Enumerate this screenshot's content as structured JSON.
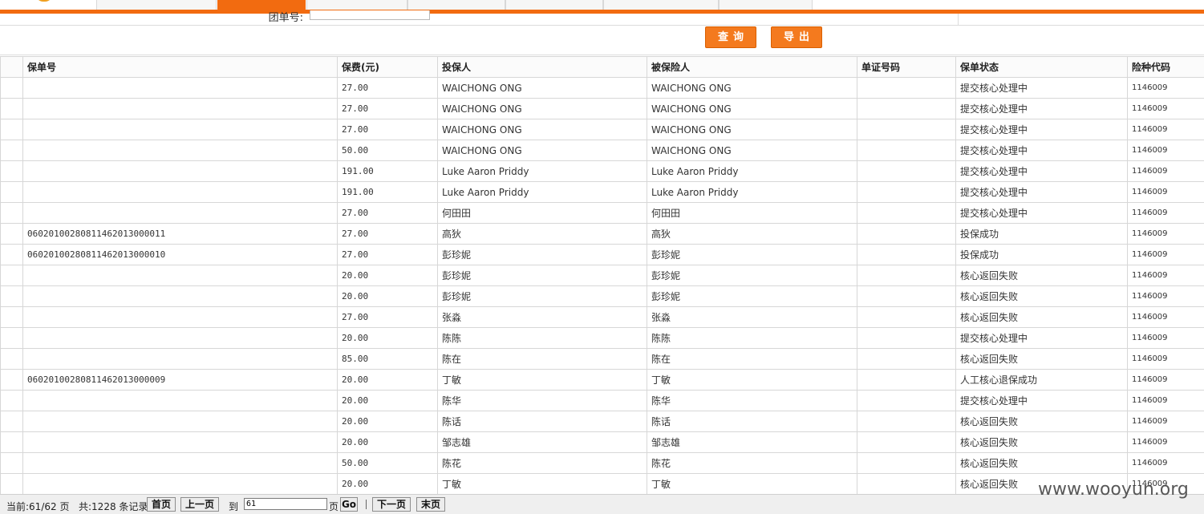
{
  "nav": {
    "tabs": [
      {
        "label": "",
        "active": false
      },
      {
        "label": "",
        "active": true
      },
      {
        "label": "",
        "active": false
      },
      {
        "label": "",
        "active": false
      },
      {
        "label": "",
        "active": false
      },
      {
        "label": "",
        "active": false
      },
      {
        "label": "",
        "active": false
      }
    ],
    "accent_color": "#f26b10"
  },
  "search": {
    "group_policy_label": "团单号:",
    "group_policy_value": "",
    "query_button": "查询",
    "export_button": "导出"
  },
  "table": {
    "headers": [
      "",
      "保单号",
      "保费(元)",
      "投保人",
      "被保险人",
      "单证号码",
      "保单状态",
      "险种代码"
    ],
    "rows": [
      {
        "policy_no": "",
        "premium": "27.00",
        "applicant": "WAICHONG ONG",
        "insured": "WAICHONG ONG",
        "cert_no": "",
        "status": "提交核心处理中",
        "product_code": "1146009"
      },
      {
        "policy_no": "",
        "premium": "27.00",
        "applicant": "WAICHONG ONG",
        "insured": "WAICHONG ONG",
        "cert_no": "",
        "status": "提交核心处理中",
        "product_code": "1146009"
      },
      {
        "policy_no": "",
        "premium": "27.00",
        "applicant": "WAICHONG ONG",
        "insured": "WAICHONG ONG",
        "cert_no": "",
        "status": "提交核心处理中",
        "product_code": "1146009"
      },
      {
        "policy_no": "",
        "premium": "50.00",
        "applicant": "WAICHONG ONG",
        "insured": "WAICHONG ONG",
        "cert_no": "",
        "status": "提交核心处理中",
        "product_code": "1146009"
      },
      {
        "policy_no": "",
        "premium": "191.00",
        "applicant": "Luke Aaron Priddy",
        "insured": "Luke Aaron Priddy",
        "cert_no": "",
        "status": "提交核心处理中",
        "product_code": "1146009"
      },
      {
        "policy_no": "",
        "premium": "191.00",
        "applicant": "Luke Aaron Priddy",
        "insured": "Luke Aaron Priddy",
        "cert_no": "",
        "status": "提交核心处理中",
        "product_code": "1146009"
      },
      {
        "policy_no": "",
        "premium": "27.00",
        "applicant": "何田田",
        "insured": "何田田",
        "cert_no": "",
        "status": "提交核心处理中",
        "product_code": "1146009"
      },
      {
        "policy_no": "0602010028081146201300001​1",
        "premium": "27.00",
        "applicant": "高狄",
        "insured": "高狄",
        "cert_no": "",
        "status": "投保成功",
        "product_code": "1146009"
      },
      {
        "policy_no": "06020100280811462013000010",
        "premium": "27.00",
        "applicant": "彭珍妮",
        "insured": "彭珍妮",
        "cert_no": "",
        "status": "投保成功",
        "product_code": "1146009"
      },
      {
        "policy_no": "",
        "premium": "20.00",
        "applicant": "彭珍妮",
        "insured": "彭珍妮",
        "cert_no": "",
        "status": "核心返回失败",
        "product_code": "1146009"
      },
      {
        "policy_no": "",
        "premium": "20.00",
        "applicant": "彭珍妮",
        "insured": "彭珍妮",
        "cert_no": "",
        "status": "核心返回失败",
        "product_code": "1146009"
      },
      {
        "policy_no": "",
        "premium": "27.00",
        "applicant": "张淼",
        "insured": "张淼",
        "cert_no": "",
        "status": "核心返回失败",
        "product_code": "1146009"
      },
      {
        "policy_no": "",
        "premium": "20.00",
        "applicant": "陈陈",
        "insured": "陈陈",
        "cert_no": "",
        "status": "提交核心处理中",
        "product_code": "1146009"
      },
      {
        "policy_no": "",
        "premium": "85.00",
        "applicant": "陈在",
        "insured": "陈在",
        "cert_no": "",
        "status": "核心返回失败",
        "product_code": "1146009"
      },
      {
        "policy_no": "06020100280811462013000009",
        "premium": "20.00",
        "applicant": "丁敏",
        "insured": "丁敏",
        "cert_no": "",
        "status": "人工核心退保成功",
        "product_code": "1146009"
      },
      {
        "policy_no": "",
        "premium": "20.00",
        "applicant": "陈华",
        "insured": "陈华",
        "cert_no": "",
        "status": "提交核心处理中",
        "product_code": "1146009"
      },
      {
        "policy_no": "",
        "premium": "20.00",
        "applicant": "陈话",
        "insured": "陈话",
        "cert_no": "",
        "status": "核心返回失败",
        "product_code": "1146009"
      },
      {
        "policy_no": "",
        "premium": "20.00",
        "applicant": "邹志雄",
        "insured": "邹志雄",
        "cert_no": "",
        "status": "核心返回失败",
        "product_code": "1146009"
      },
      {
        "policy_no": "",
        "premium": "50.00",
        "applicant": "陈花",
        "insured": "陈花",
        "cert_no": "",
        "status": "核心返回失败",
        "product_code": "1146009"
      },
      {
        "policy_no": "",
        "premium": "20.00",
        "applicant": "丁敏",
        "insured": "丁敏",
        "cert_no": "",
        "status": "核心返回失败",
        "product_code": "1146009"
      }
    ]
  },
  "pager": {
    "current_label": "当前:61/62 页",
    "total_label": "共:1228 条记录",
    "first": "首页",
    "prev": "上一页",
    "goto_label": "到",
    "goto_value": "61",
    "page_unit": "页",
    "go": "Go",
    "next": "下一页",
    "last": "末页"
  },
  "watermark": "www.wooyun.org"
}
